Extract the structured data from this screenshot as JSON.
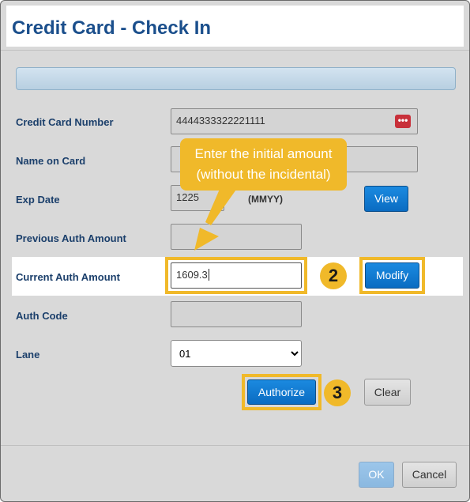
{
  "dialog": {
    "title": "Credit Card - Check In"
  },
  "form": {
    "card_number_label": "Credit Card Number",
    "card_number_value": "4444333322221111",
    "card_icon": "credit-card-icon",
    "name_label": "Name on Card",
    "exp_label": "Exp Date",
    "exp_value": "1225",
    "exp_format": "(MMYY)",
    "view_button": "View",
    "prev_auth_label": "Previous Auth Amount",
    "current_auth_label": "Current Auth Amount",
    "current_auth_value": "1609.3",
    "modify_button": "Modify",
    "auth_code_label": "Auth Code",
    "lane_label": "Lane",
    "lane_value": "01",
    "authorize_button": "Authorize",
    "clear_button": "Clear"
  },
  "annotations": {
    "callout_line1": "Enter the initial amount",
    "callout_line2": "(without the incidental)",
    "step2": "2",
    "step3": "3",
    "highlight_color": "#f0b92a"
  },
  "footer": {
    "ok_button": "OK",
    "cancel_button": "Cancel"
  }
}
